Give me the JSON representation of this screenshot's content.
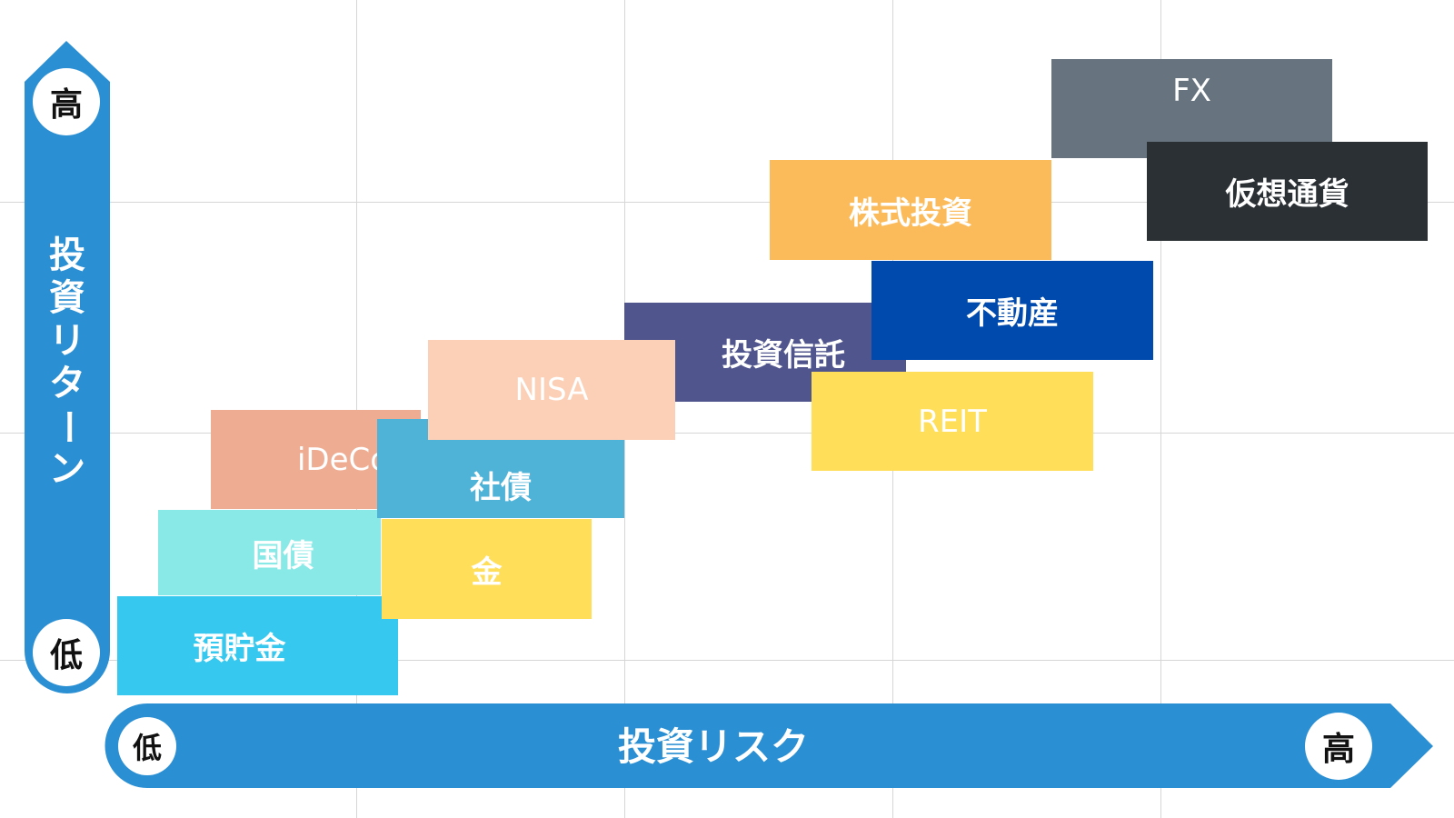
{
  "diagram": {
    "title_y_axis": "投資リターン",
    "title_y_chars": [
      "投",
      "資",
      "リ",
      "タ",
      "ー",
      "ン"
    ],
    "title_x_axis": "投資リスク",
    "y_high_label": "高",
    "y_low_label": "低",
    "x_low_label": "低",
    "x_high_label": "高",
    "axis_color": "#2b8fd3"
  },
  "items": [
    {
      "id": "fx",
      "label": "FX",
      "color": "#67747f"
    },
    {
      "id": "crypto",
      "label": "仮想通貨",
      "color": "#2b3035"
    },
    {
      "id": "stocks",
      "label": "株式投資",
      "color": "#fcbb5a"
    },
    {
      "id": "real-estate",
      "label": "不動産",
      "color": "#004aad"
    },
    {
      "id": "mutual-fund",
      "label": "投資信託",
      "color": "#50558d"
    },
    {
      "id": "reit",
      "label": "REIT",
      "color": "#ffde59"
    },
    {
      "id": "nisa",
      "label": "NISA",
      "color": "#fcd0b7"
    },
    {
      "id": "ideco",
      "label": "iDeCo",
      "color": "#eeac93"
    },
    {
      "id": "corporate-bond",
      "label": "社債",
      "color": "#4fb3d8"
    },
    {
      "id": "gold",
      "label": "金",
      "color": "#ffde59"
    },
    {
      "id": "jgb",
      "label": "国債",
      "color": "#88e9e6"
    },
    {
      "id": "savings",
      "label": "預貯金",
      "color": "#36c8ee"
    }
  ]
}
